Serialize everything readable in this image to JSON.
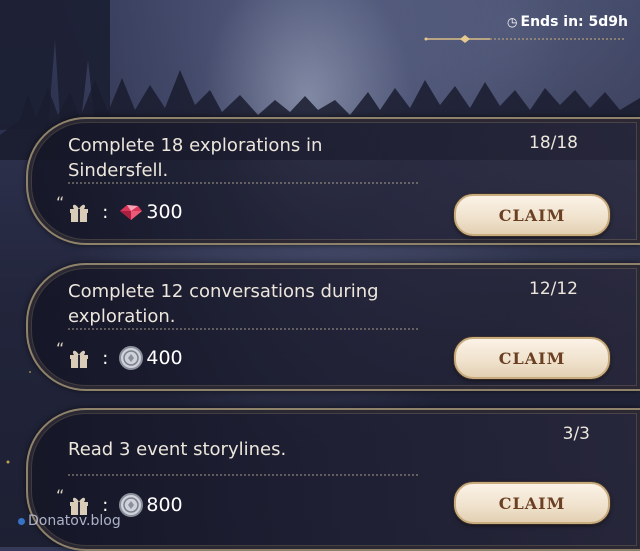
{
  "timer": {
    "icon": "clock-icon",
    "text": "Ends in: 5d9h"
  },
  "quests": [
    {
      "title": "Complete 18 explorations in Sindersfell.",
      "progress": "18/18",
      "reward_icon": "crystal-icon",
      "reward_amount": "300",
      "button_label": "CLAIM"
    },
    {
      "title": "Complete 12 conversations during exploration.",
      "progress": "12/12",
      "reward_icon": "silver-coin-icon",
      "reward_amount": "400",
      "button_label": "CLAIM"
    },
    {
      "title": "Read 3 event storylines.",
      "progress": "3/3",
      "reward_icon": "silver-coin-icon",
      "reward_amount": "800",
      "button_label": "CLAIM"
    }
  ],
  "reward_separator": ":",
  "quote_mark": "“",
  "watermark": "Donatov.blog"
}
